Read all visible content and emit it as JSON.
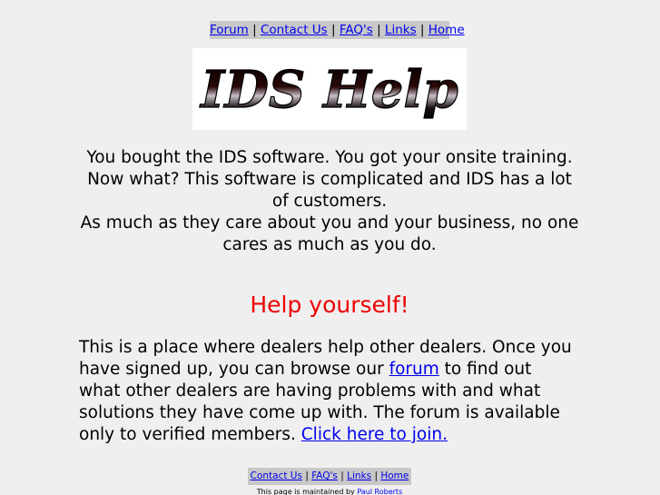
{
  "nav_top": {
    "forum": "Forum",
    "contact": "Contact Us",
    "faq": "FAQ's",
    "links": "Links",
    "home": "Home",
    "separator": "|"
  },
  "logo": {
    "text": "IDS Help",
    "colors": {
      "fill": "#000000",
      "highlight": "#c8c0c8",
      "accent": "#6b1818"
    }
  },
  "intro": {
    "line1": "You bought the IDS software. You got your onsite training.",
    "line2": "Now what? This software is complicated and IDS has a lot of customers.",
    "line3": "As much as they care about you and your business, no one cares as much as you do."
  },
  "tagline": "Help yourself!",
  "body": {
    "text1": "This is a place where dealers help other dealers. Once you have signed up, you can browse our ",
    "forum_link": "forum",
    "text2": " to find out what other dealers are having problems with and what solutions they have come up with. The forum is available only to verified members. ",
    "join_link": "Click here to join."
  },
  "nav_bottom": {
    "contact": "Contact Us",
    "faq": "FAQ's",
    "links": "Links",
    "home": "Home",
    "separator": "|"
  },
  "footer": {
    "prefix": "This page is maintained by ",
    "author": "Paul Roberts"
  },
  "colors": {
    "background": "#efefef",
    "nav_bg": "#c8c8c8",
    "link": "#0000ee",
    "tagline": "#ee0000"
  }
}
